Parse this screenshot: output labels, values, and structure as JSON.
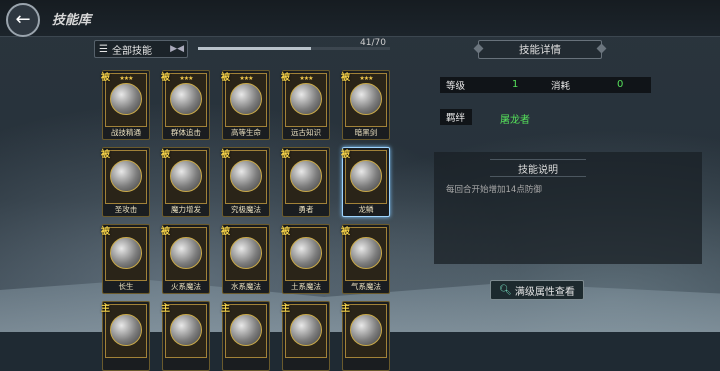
{
  "header": {
    "title": "技能库",
    "back_icon": "back-arrow-icon"
  },
  "filter": {
    "label": "全部技能",
    "icon": "list-icon",
    "arrows": "▶◀"
  },
  "progress": {
    "text": "41/70",
    "fraction": 0.586
  },
  "cards": [
    {
      "tag": "被",
      "stars": "★★★",
      "name": "战技精通",
      "sel": false
    },
    {
      "tag": "被",
      "stars": "★★★",
      "name": "群体追击",
      "sel": false
    },
    {
      "tag": "被",
      "stars": "★★★",
      "name": "高等生命",
      "sel": false
    },
    {
      "tag": "被",
      "stars": "★★★",
      "name": "远古知识",
      "sel": false
    },
    {
      "tag": "被",
      "stars": "★★★",
      "name": "暗黑剑",
      "sel": false
    },
    {
      "tag": "被",
      "stars": "",
      "name": "圣攻击",
      "sel": false
    },
    {
      "tag": "被",
      "stars": "",
      "name": "魔力增发",
      "sel": false
    },
    {
      "tag": "被",
      "stars": "",
      "name": "究极魔法",
      "sel": false
    },
    {
      "tag": "被",
      "stars": "",
      "name": "勇者",
      "sel": false
    },
    {
      "tag": "被",
      "stars": "",
      "name": "龙鳞",
      "sel": true
    },
    {
      "tag": "被",
      "stars": "",
      "name": "长生",
      "sel": false
    },
    {
      "tag": "被",
      "stars": "",
      "name": "火系魔法",
      "sel": false
    },
    {
      "tag": "被",
      "stars": "",
      "name": "水系魔法",
      "sel": false
    },
    {
      "tag": "被",
      "stars": "",
      "name": "土系魔法",
      "sel": false
    },
    {
      "tag": "被",
      "stars": "",
      "name": "气系魔法",
      "sel": false
    },
    {
      "tag": "主",
      "stars": "",
      "name": "",
      "sel": false
    },
    {
      "tag": "主",
      "stars": "",
      "name": "",
      "sel": false
    },
    {
      "tag": "主",
      "stars": "",
      "name": "",
      "sel": false
    },
    {
      "tag": "主",
      "stars": "",
      "name": "",
      "sel": false
    },
    {
      "tag": "主",
      "stars": "",
      "name": "",
      "sel": false
    }
  ],
  "details": {
    "title": "技能详情",
    "level_label": "等级",
    "level_value": "1",
    "cost_label": "消耗",
    "cost_value": "0",
    "bond_label": "羁绊",
    "bond_value": "屠龙者",
    "desc_title": "技能说明",
    "desc_text": "每回合开始增加14点防御",
    "full_button": "满级属性查看"
  },
  "colors": {
    "accent_green": "#55e05a",
    "gold": "#f4d24a",
    "select": "#9fd5ff"
  }
}
